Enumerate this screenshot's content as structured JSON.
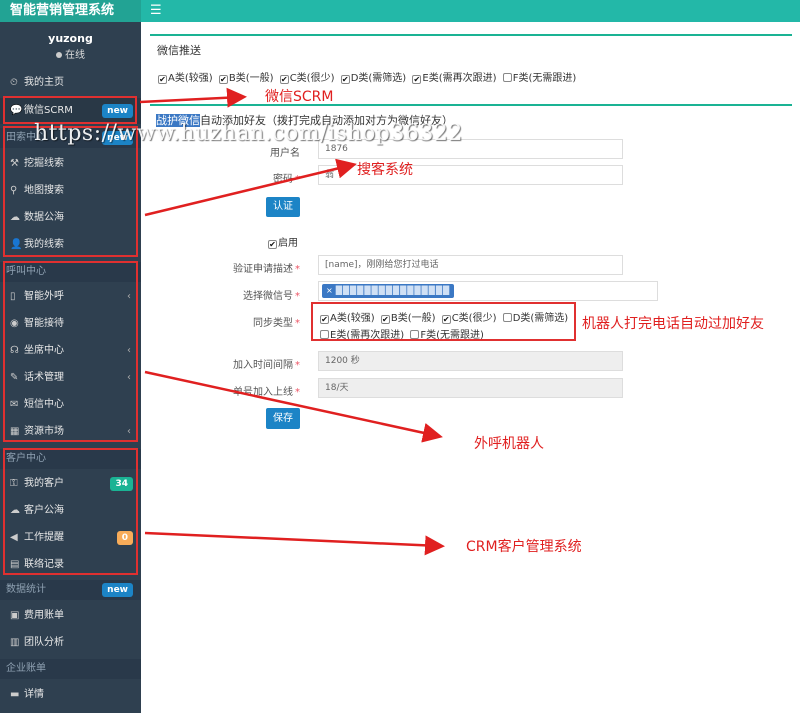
{
  "app": {
    "brand": "智能营销管理系统"
  },
  "user": {
    "name": "yuzong",
    "status": "在线"
  },
  "sidebar": {
    "items": [
      {
        "label": "我的主页",
        "icon": "dashboard-icon",
        "glyph": "⏲"
      },
      {
        "label": "微信SCRM",
        "icon": "wechat-icon",
        "glyph": "💬",
        "badge": "new"
      },
      {
        "label": "挖掘线索",
        "icon": "pick-icon",
        "glyph": "⚒"
      },
      {
        "label": "地图搜索",
        "icon": "map-marker-icon",
        "glyph": "⚲"
      },
      {
        "label": "数据公海",
        "icon": "cloud-icon",
        "glyph": "☁"
      },
      {
        "label": "我的线索",
        "icon": "user-icon",
        "glyph": "👤"
      },
      {
        "label": "智能外呼",
        "icon": "mobile-icon",
        "glyph": "▯"
      },
      {
        "label": "智能接待",
        "icon": "eye-icon",
        "glyph": "◉"
      },
      {
        "label": "坐席中心",
        "icon": "headphones-icon",
        "glyph": "☊"
      },
      {
        "label": "话术管理",
        "icon": "graduation-icon",
        "glyph": "✎"
      },
      {
        "label": "短信中心",
        "icon": "comment-icon",
        "glyph": "✉"
      },
      {
        "label": "资源市场",
        "icon": "grid-icon",
        "glyph": "▦"
      },
      {
        "label": "我的客户",
        "icon": "lock-icon",
        "glyph": "⚿",
        "badge": "34"
      },
      {
        "label": "客户公海",
        "icon": "cloud-icon",
        "glyph": "☁"
      },
      {
        "label": "工作提醒",
        "icon": "volume-icon",
        "glyph": "◀",
        "badge": "0"
      },
      {
        "label": "联络记录",
        "icon": "list-icon",
        "glyph": "▤"
      },
      {
        "label": "费用账单",
        "icon": "bill-icon",
        "glyph": "▣"
      },
      {
        "label": "团队分析",
        "icon": "chart-icon",
        "glyph": "▥"
      },
      {
        "label": "详情",
        "icon": "detail-icon",
        "glyph": "▬"
      }
    ],
    "sections": [
      {
        "label": "田索中心",
        "badge": "new"
      },
      {
        "label": "呼叫中心"
      },
      {
        "label": "客户中心"
      },
      {
        "label": "数据统计",
        "badge": "new"
      },
      {
        "label": "企业账单"
      }
    ]
  },
  "wechat_push": {
    "title": "微信推送",
    "types": [
      {
        "label": "A类(较强)",
        "checked": true
      },
      {
        "label": "B类(一般)",
        "checked": true
      },
      {
        "label": "C类(很少)",
        "checked": true
      },
      {
        "label": "D类(需筛选)",
        "checked": true
      },
      {
        "label": "E类(需再次跟进)",
        "checked": true
      },
      {
        "label": "F类(无需跟进)",
        "checked": false
      }
    ]
  },
  "auto_add": {
    "title_highlight": "战护微信",
    "title_rest": "自动添加好友（拨打完成自动添加对方为微信好友）",
    "username_label": "用户名",
    "username_value": "1876",
    "password_label": "密码",
    "password_value": "翁",
    "auth_button": "认证",
    "enable_label": "启用",
    "verify_label": "验证申请描述",
    "verify_value": "[name]，刚刚给您打过电话",
    "wechat_label": "选择微信号",
    "wechat_tag_close": "×",
    "sync_label": "同步类型",
    "sync_types": [
      {
        "label": "A类(较强)",
        "checked": true
      },
      {
        "label": "B类(一般)",
        "checked": true
      },
      {
        "label": "C类(很少)",
        "checked": true
      },
      {
        "label": "D类(需筛选)",
        "checked": false
      },
      {
        "label": "E类(需再次跟进)",
        "checked": false
      },
      {
        "label": "F类(无需跟进)",
        "checked": false
      }
    ],
    "interval_label": "加入时间间隔",
    "interval_value": "1200 秒",
    "limit_label": "单号加入上线",
    "limit_value": "18/天",
    "save_button": "保存"
  },
  "annotations": {
    "wechat_scrm": "微信SCRM",
    "lead_system": "搜客系统",
    "robot_friend": "机器人打完电话自动过加好友",
    "call_robot": "外呼机器人",
    "crm": "CRM客户管理系统",
    "watermark": "https://www.huzhan.com/ishop36322",
    "color": "#e02020"
  },
  "colors": {
    "sidebar": "#2f4050",
    "accent": "#1ab394",
    "primary": "#1c84c6",
    "topbar": "#23b8a8"
  }
}
